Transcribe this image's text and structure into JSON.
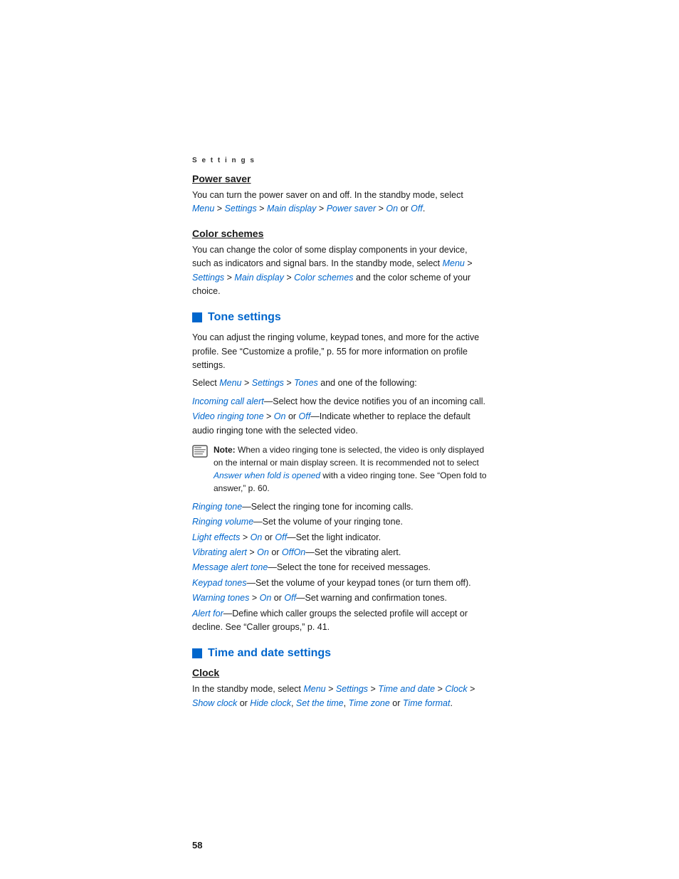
{
  "page": {
    "section_label": "S e t t i n g s",
    "page_number": "58",
    "power_saver": {
      "heading": "Power saver",
      "body": "You can turn the power saver on and off. In the standby mode, select ",
      "link1": "Menu",
      "sep1": " > ",
      "link2": "Settings",
      "sep2": " > ",
      "link3": "Main display",
      "sep3": " > ",
      "link4": "Power saver",
      "sep4": " > ",
      "link5": "On",
      "sep5": " or ",
      "link6": "Off",
      "end": "."
    },
    "color_schemes": {
      "heading": "Color schemes",
      "body1": "You can change the color of some display components in your device, such as indicators and signal bars. In the standby mode, select ",
      "link1": "Menu",
      "sep1": " > ",
      "link2": "Settings",
      "sep2": " > ",
      "link3": "Main display",
      "body2": " > ",
      "link4": "Color schemes",
      "body3": " and the color scheme of your choice."
    },
    "tone_settings": {
      "heading": "Tone settings",
      "intro1": "You can adjust the ringing volume, keypad tones, and more for the active profile. See “Customize a profile,” p. 55 for more information on profile settings.",
      "intro2_before": "Select ",
      "intro2_menu": "Menu",
      "intro2_sep1": " > ",
      "intro2_settings": "Settings",
      "intro2_sep2": " > ",
      "intro2_tones": "Tones",
      "intro2_after": " and one of the following:",
      "items": [
        {
          "link": "Incoming call alert",
          "dash": "—",
          "text": "Select how the device notifies you of an incoming call."
        },
        {
          "link": "Video ringing tone",
          "dash": " > ",
          "link2": "On",
          "text2": " or ",
          "link3": "Off",
          "text": "—Indicate whether to replace the default audio ringing tone with the selected video."
        }
      ],
      "note": {
        "label": "Note:",
        "text1": " When a video ringing tone is selected, the video is only displayed on the internal or main display screen. It is recommended not to select ",
        "link": "Answer when fold is opened",
        "text2": " with a video ringing tone. See “Open fold to answer,” p. 60."
      },
      "list_items": [
        {
          "link": "Ringing tone",
          "text": "—Select the ringing tone for incoming calls."
        },
        {
          "link": "Ringing volume",
          "text": "—Set the volume of your ringing tone."
        },
        {
          "link": "Light effects",
          "text": " > ",
          "link2": "On",
          "text2": " or ",
          "link3": "Off",
          "text3": "—Set the light indicator."
        },
        {
          "link": "Vibrating alert",
          "text": " > ",
          "link2": "On",
          "text2": " or ",
          "link3": "OffOn",
          "text3": "—Set the vibrating alert."
        },
        {
          "link": "Message alert tone",
          "text": "—Select the tone for received messages."
        },
        {
          "link": "Keypad tones",
          "text": "—Set the volume of your keypad tones (or turn them off)."
        },
        {
          "link": "Warning tones",
          "text": " > ",
          "link2": "On",
          "text2": " or ",
          "link3": "Off",
          "text3": "—Set warning and confirmation tones."
        },
        {
          "link": "Alert for",
          "text": "—Define which caller groups the selected profile will accept or decline. See “Caller groups,” p. 41."
        }
      ]
    },
    "time_date": {
      "heading": "Time and date settings",
      "clock": {
        "heading": "Clock",
        "body_before": "In the standby mode, select ",
        "link1": "Menu",
        "sep1": " > ",
        "link2": "Settings",
        "sep2": " > ",
        "link3": "Time and date",
        "sep3": " > ",
        "link4": "Clock",
        "sep4": " > ",
        "link5": "Show clock",
        "sep5": " or ",
        "link6": "Hide clock",
        "sep6": ", ",
        "link7": "Set the time",
        "sep7": ", ",
        "link8": "Time zone",
        "sep8": " or ",
        "link9": "Time format",
        "end": "."
      }
    }
  }
}
